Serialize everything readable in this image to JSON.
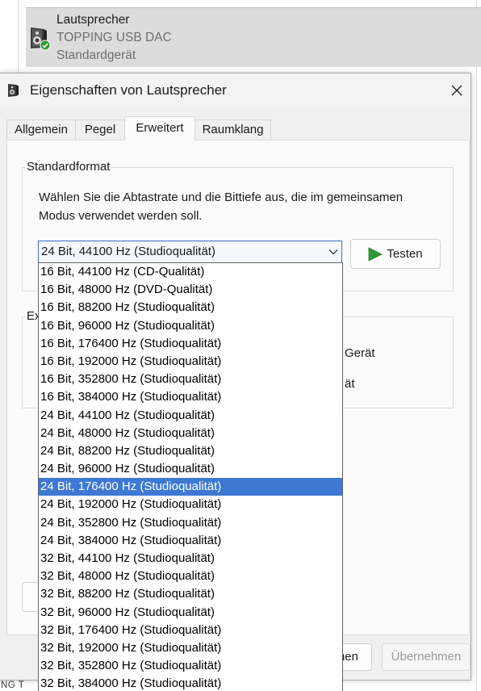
{
  "background_window": {
    "device": {
      "name": "Lautsprecher",
      "description": "TOPPING USB DAC",
      "status": "Standardgerät",
      "icon": "speaker-icon",
      "status_icon": "default-device-check-icon"
    },
    "clipped_text": "NG T"
  },
  "dialog": {
    "title": "Eigenschaften von Lautsprecher",
    "title_icon": "speaker-icon",
    "close_icon": "close-icon",
    "tabs": [
      {
        "label": "Allgemein"
      },
      {
        "label": "Pegel"
      },
      {
        "label": "Erweitert"
      },
      {
        "label": "Raumklang"
      }
    ],
    "selected_tab_index": 2,
    "default_format": {
      "group_label": "Standardformat",
      "description_lines": [
        "Wählen Sie die Abtastrate und die Bittiefe aus, die im gemeinsamen",
        "Modus verwendet werden soll."
      ],
      "selected_value": "24 Bit, 44100 Hz (Studioqualität)",
      "dropdown_open": true,
      "chevron_icon": "chevron-down-icon",
      "test_button_label": "Testen",
      "test_button_icon": "play-icon",
      "options": [
        "16 Bit, 44100 Hz (CD-Qualität)",
        "16 Bit, 48000 Hz (DVD-Qualität)",
        "16 Bit, 88200 Hz (Studioqualität)",
        "16 Bit, 96000 Hz (Studioqualität)",
        "16 Bit, 176400 Hz (Studioqualität)",
        "16 Bit, 192000 Hz (Studioqualität)",
        "16 Bit, 352800 Hz (Studioqualität)",
        "16 Bit, 384000 Hz (Studioqualität)",
        "24 Bit, 44100 Hz (Studioqualität)",
        "24 Bit, 48000 Hz (Studioqualität)",
        "24 Bit, 88200 Hz (Studioqualität)",
        "24 Bit, 96000 Hz (Studioqualität)",
        "24 Bit, 176400 Hz (Studioqualität)",
        "24 Bit, 192000 Hz (Studioqualität)",
        "24 Bit, 352800 Hz (Studioqualität)",
        "24 Bit, 384000 Hz (Studioqualität)",
        "32 Bit, 44100 Hz (Studioqualität)",
        "32 Bit, 48000 Hz (Studioqualität)",
        "32 Bit, 88200 Hz (Studioqualität)",
        "32 Bit, 96000 Hz (Studioqualität)",
        "32 Bit, 176400 Hz (Studioqualität)",
        "32 Bit, 192000 Hz (Studioqualität)",
        "32 Bit, 352800 Hz (Studioqualität)",
        "32 Bit, 384000 Hz (Studioqualität)"
      ],
      "highlighted_index": 12
    },
    "exclusive_mode": {
      "group_label_visible": "Ex",
      "visible_option_fragments": [
        "Gerät",
        "ät"
      ]
    },
    "buttons": {
      "cancel_visible_label": "hen",
      "apply_label": "Übernehmen",
      "apply_enabled": false
    }
  },
  "colors": {
    "highlight": "#3d78d4",
    "highlight_text": "#ffffff",
    "play_icon": "#2f9a35",
    "status_check": "#2f9a35",
    "disabled_text": "#9a9a9a"
  }
}
